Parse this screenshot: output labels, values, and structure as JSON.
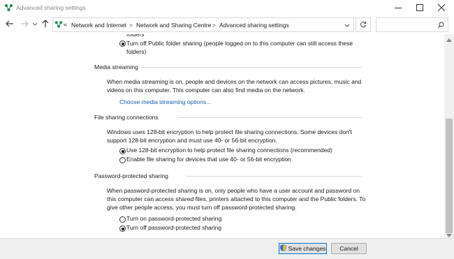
{
  "window": {
    "title": "Advanced sharing settings"
  },
  "address": {
    "overflow": "«",
    "crumbs": [
      "Network and Internet",
      "Network and Sharing Centre",
      "Advanced sharing settings"
    ],
    "separator": ">"
  },
  "search": {
    "placeholder": ""
  },
  "public_folder": {
    "cutoff_text": "folders",
    "option_off_line1": "Turn off Public folder sharing (people logged on to this computer can still access these",
    "option_off_line2": "folders)"
  },
  "media_streaming": {
    "heading": "Media streaming",
    "para_line1": "When media streaming is on, people and devices on the network can access pictures, music and",
    "para_line2": "videos on this computer. This computer can also find media on the network.",
    "link": "Choose media streaming options..."
  },
  "file_sharing": {
    "heading": "File sharing connections",
    "para_line1": "Windows uses 128-bit encryption to help protect file sharing connections. Some devices don't",
    "para_line2": "support 128-bit encryption and must use 40- or 56-bit encryption.",
    "option_128": "Use 128-bit encryption to help protect file sharing connections (recommended)",
    "option_40_56": "Enable file sharing for devices that use 40- or 56-bit encryption"
  },
  "password_sharing": {
    "heading": "Password-protected sharing",
    "para_line1": "When password-protected sharing is on, only people who have a user account and password on",
    "para_line2": "this computer can access shared files, printers attached to this computer and the Public folders. To",
    "para_line3": "give other people access, you must turn off password-protected sharing.",
    "option_on": "Turn on password-protected sharing",
    "option_off": "Turn off password-protected sharing"
  },
  "footer": {
    "save_label": "Save changes",
    "cancel_label": "Cancel"
  },
  "colors": {
    "link": "#1a5fb4",
    "network_icon": "#2e8b57",
    "primary_border": "#0078d7"
  },
  "icons": {
    "app": "network-icon",
    "shield": "uac-shield-icon"
  }
}
